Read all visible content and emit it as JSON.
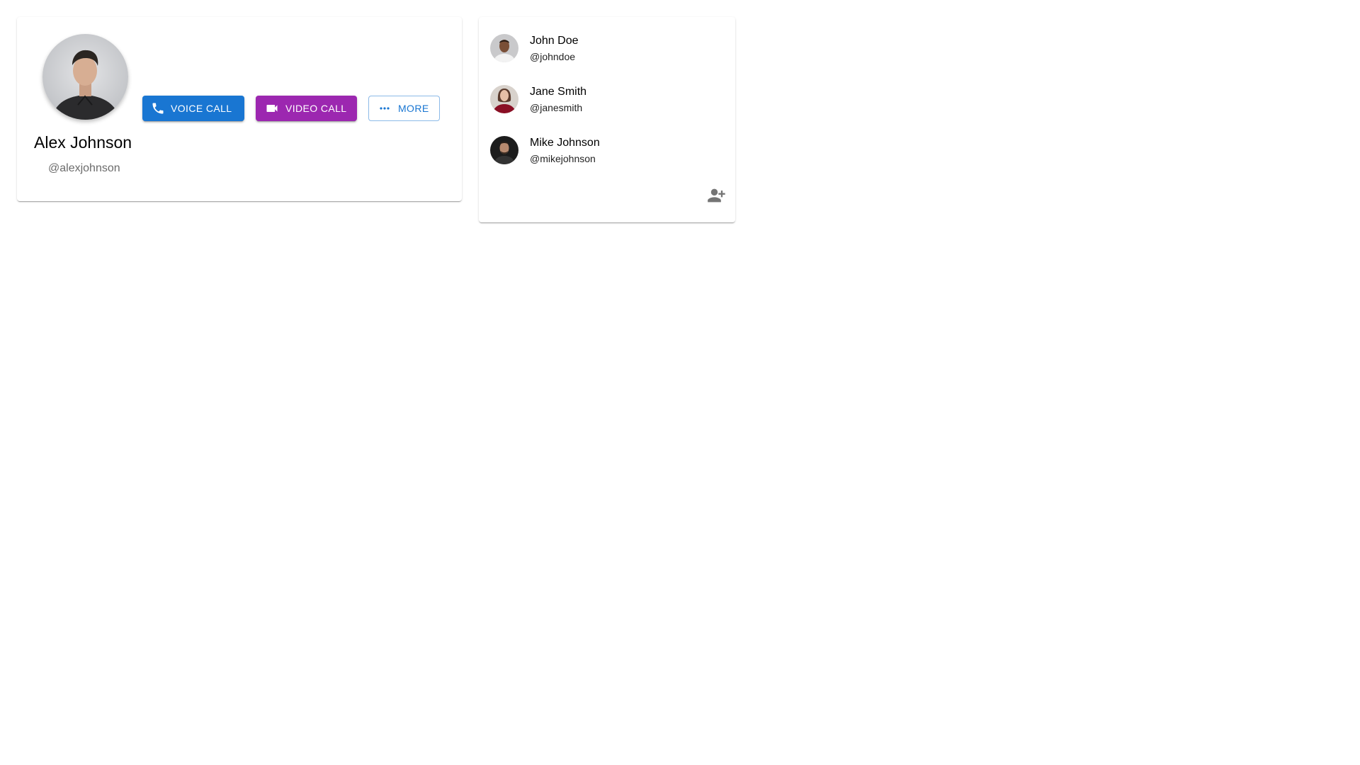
{
  "profile": {
    "name": "Alex Johnson",
    "handle": "@alexjohnson",
    "actions": {
      "voice_call": "VOICE CALL",
      "video_call": "VIDEO CALL",
      "more": "MORE"
    }
  },
  "contacts": [
    {
      "name": "John Doe",
      "handle": "@johndoe"
    },
    {
      "name": "Jane Smith",
      "handle": "@janesmith"
    },
    {
      "name": "Mike Johnson",
      "handle": "@mikejohnson"
    }
  ],
  "colors": {
    "primary": "#1976d2",
    "secondary": "#9c27b0",
    "icon_gray": "#757575"
  },
  "icons": {
    "voice_call": "phone-icon",
    "video_call": "videocam-icon",
    "more": "more-horiz-icon",
    "add_contact": "person-add-icon"
  }
}
